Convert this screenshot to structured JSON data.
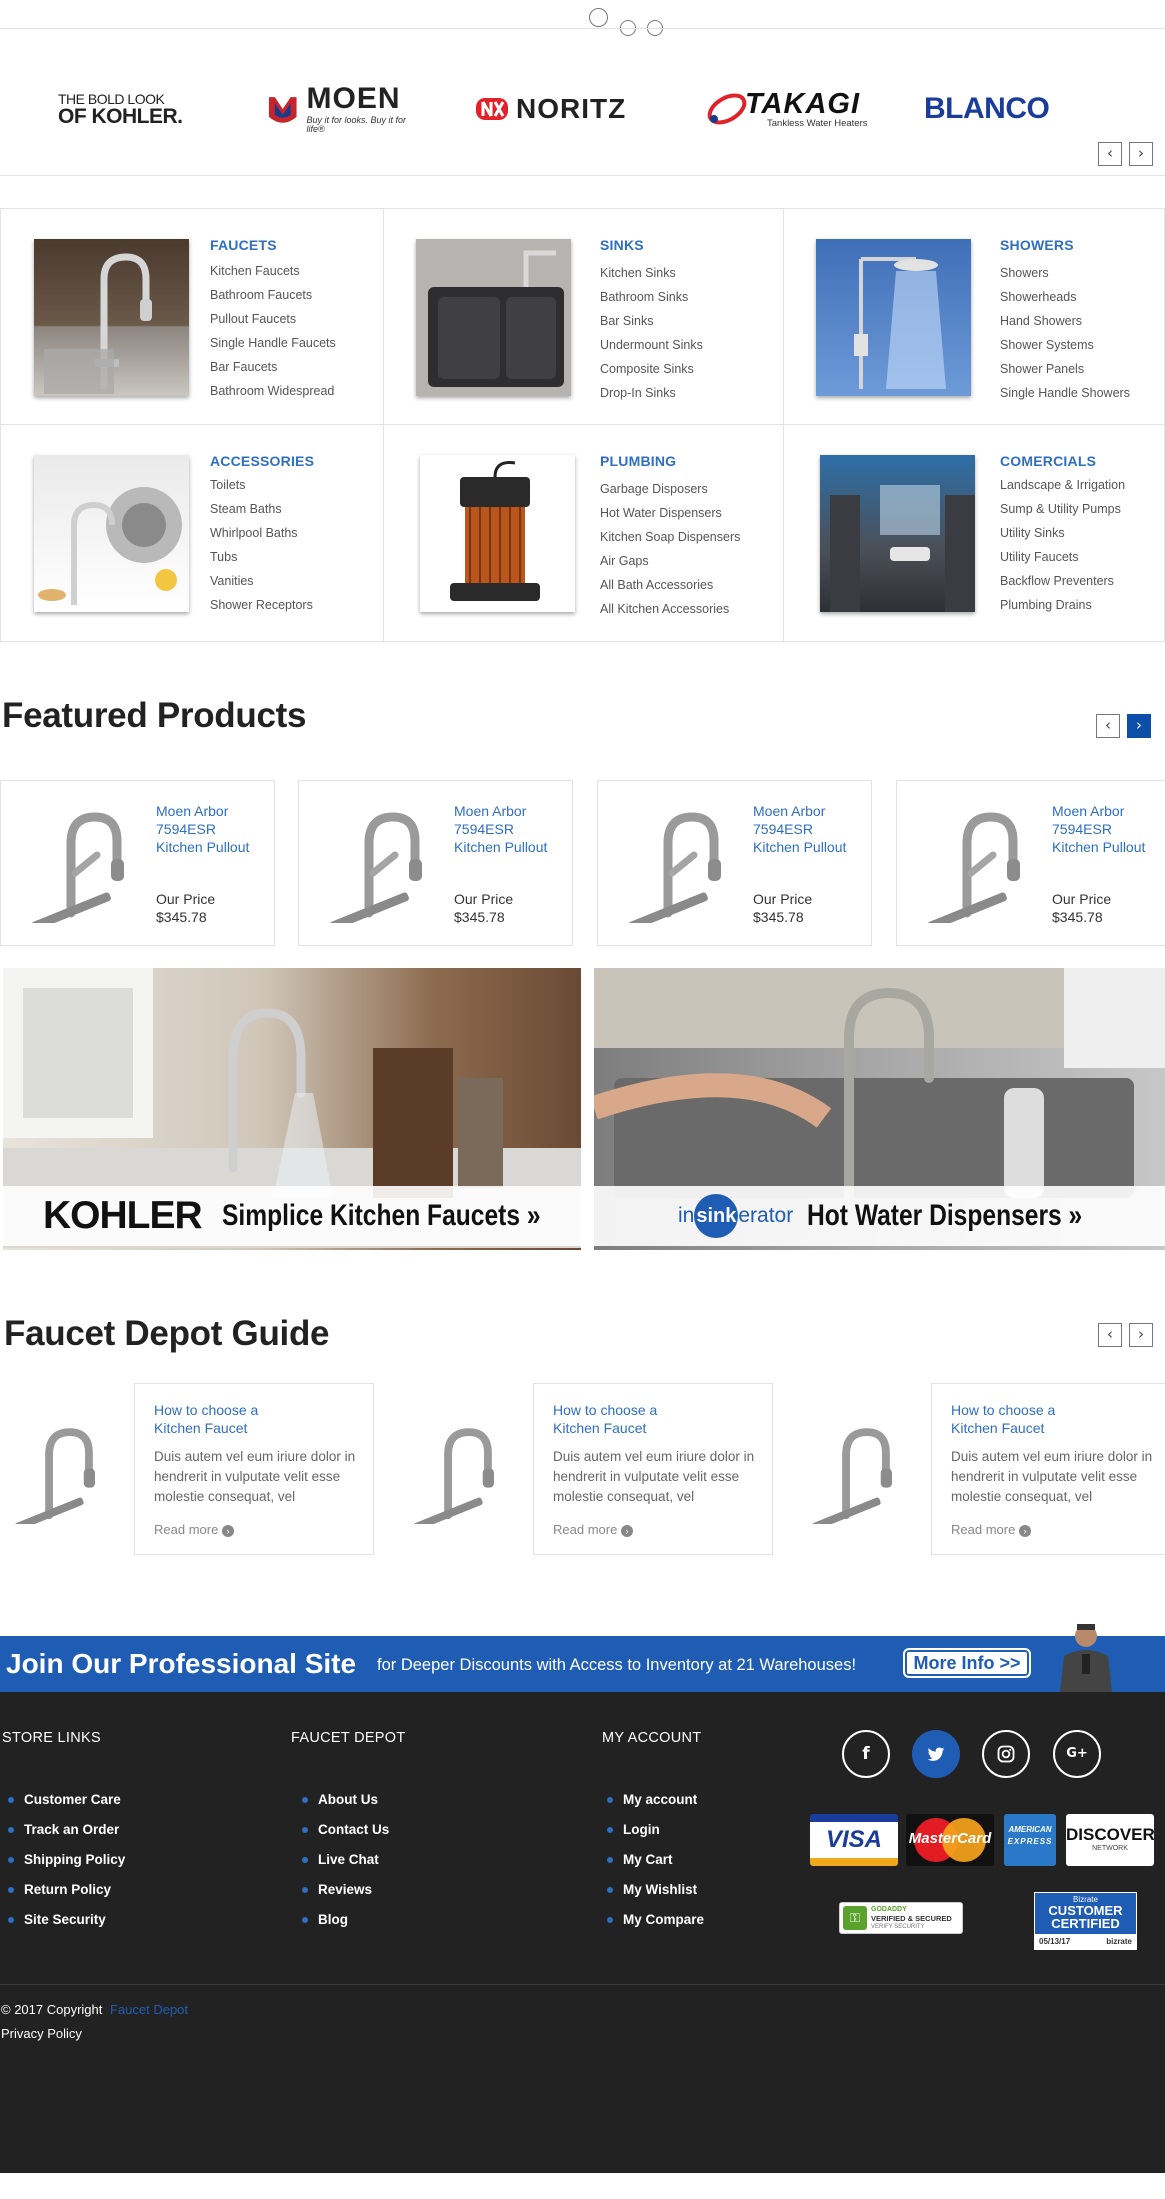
{
  "brands": {
    "items": [
      {
        "name": "kohler",
        "line1": "THE BOLD LOOK",
        "line2": "OF KOHLER."
      },
      {
        "name": "moen",
        "text": "MOEN",
        "tagline": "Buy it for looks. Buy it for life®"
      },
      {
        "name": "noritz",
        "text": "NORITZ"
      },
      {
        "name": "takagi",
        "text": "TAKAGI",
        "tagline": "Tankless Water Heaters"
      },
      {
        "name": "blanco",
        "text": "BLANCO"
      }
    ],
    "prev": "‹",
    "next": "›"
  },
  "categories": [
    {
      "title": "FAUCETS",
      "links": [
        "Kitchen Faucets",
        "Bathroom Faucets",
        "Pullout Faucets",
        "Single Handle Faucets",
        "Bar Faucets",
        "Bathroom Widespread"
      ]
    },
    {
      "title": "SINKS",
      "links": [
        "Kitchen Sinks",
        "Bathroom Sinks",
        "Bar Sinks",
        "Undermount Sinks",
        "Composite Sinks",
        "Drop-In Sinks"
      ]
    },
    {
      "title": "SHOWERS",
      "links": [
        "Showers",
        "Showerheads",
        "Hand Showers",
        "Shower Systems",
        "Shower Panels",
        "Single Handle Showers"
      ]
    },
    {
      "title": "ACCESSORIES",
      "links": [
        "Toilets",
        "Steam Baths",
        "Whirlpool Baths",
        "Tubs",
        "Vanities",
        "Shower Receptors"
      ]
    },
    {
      "title": "PLUMBING",
      "links": [
        "Garbage Disposers",
        "Hot Water Dispensers",
        "Kitchen Soap Dispensers",
        "Air Gaps",
        "All Bath Accessories",
        "All Kitchen Accessories"
      ]
    },
    {
      "title": "COMERCIALS",
      "links": [
        "Landscape & Irrigation",
        "Sump & Utility Pumps",
        "Utility Sinks",
        "Utility Faucets",
        "Backflow Preventers",
        "Plumbing Drains"
      ]
    }
  ],
  "featured": {
    "title": "Featured Products",
    "products": [
      {
        "name": "Moen Arbor 7594ESR Kitchen Pullout",
        "price_label": "Our Price",
        "price": "$345.78"
      },
      {
        "name": "Moen Arbor 7594ESR Kitchen Pullout",
        "price_label": "Our Price",
        "price": "$345.78"
      },
      {
        "name": "Moen Arbor 7594ESR Kitchen Pullout",
        "price_label": "Our Price",
        "price": "$345.78"
      },
      {
        "name": "Moen Arbor 7594ESR Kitchen Pullout",
        "price_label": "Our Price",
        "price": "$345.78"
      }
    ]
  },
  "banners": {
    "left": {
      "brand": "KOHLER",
      "text": "Simplice Kitchen Faucets »"
    },
    "right": {
      "brand_pre": "in",
      "brand_mid": "sink",
      "brand_post": "erator",
      "text": "Hot Water Dispensers »"
    }
  },
  "guide": {
    "title": "Faucet Depot Guide",
    "posts": [
      {
        "title": "How to choose a Kitchen Faucet",
        "excerpt": "Duis autem vel eum iriure dolor in hendrerit in vulputate velit esse molestie consequat, vel",
        "more": "Read more"
      },
      {
        "title": "How to choose a Kitchen Faucet",
        "excerpt": "Duis autem vel eum iriure dolor in hendrerit in vulputate velit esse molestie consequat, vel",
        "more": "Read more"
      },
      {
        "title": "How to choose a Kitchen Faucet",
        "excerpt": "Duis autem vel eum iriure dolor in hendrerit in vulputate velit esse molestie consequat, vel",
        "more": "Read more"
      }
    ]
  },
  "join": {
    "title": "Join Our Professional Site",
    "subtitle": "for Deeper Discounts with Access to Inventory at 21 Warehouses!",
    "button": "More Info >>"
  },
  "footer": {
    "store_links": {
      "heading": "STORE LINKS",
      "items": [
        "Customer Care",
        "Track an Order",
        "Shipping Policy",
        "Return Policy",
        "Site Security"
      ]
    },
    "faucet_depot": {
      "heading": "FAUCET DEPOT",
      "items": [
        "About Us",
        "Contact Us",
        "Live Chat",
        "Reviews",
        "Blog"
      ]
    },
    "my_account": {
      "heading": "MY ACCOUNT",
      "items": [
        "My account",
        "Login",
        "My Cart",
        "My Wishlist",
        "My Compare"
      ]
    },
    "social_icons": [
      "facebook-icon",
      "twitter-icon",
      "instagram-icon",
      "google-plus-icon"
    ],
    "cards": {
      "visa": "VISA",
      "mastercard": "MasterCard",
      "amex_1": "AMERICAN",
      "amex_2": "EXPRESS",
      "discover": "DISCOVER",
      "discover_sub": "NETWORK"
    },
    "godaddy": {
      "line1": "GODADDY",
      "line2": "VERIFIED & SECURED",
      "line3": "VERIFY SECURITY"
    },
    "bizrate": {
      "top": "Bizrate",
      "line1": "CUSTOMER",
      "line2": "CERTIFIED",
      "date": "05/13/17",
      "brand": "bizrate"
    },
    "copyright_prefix": "© 2017  Copyright",
    "copyright_link": "Faucet Depot",
    "privacy": "Privacy Policy"
  },
  "colors": {
    "accent": "#2f6fc0",
    "primary": "#1f5db4",
    "footer_bg": "#222222"
  }
}
